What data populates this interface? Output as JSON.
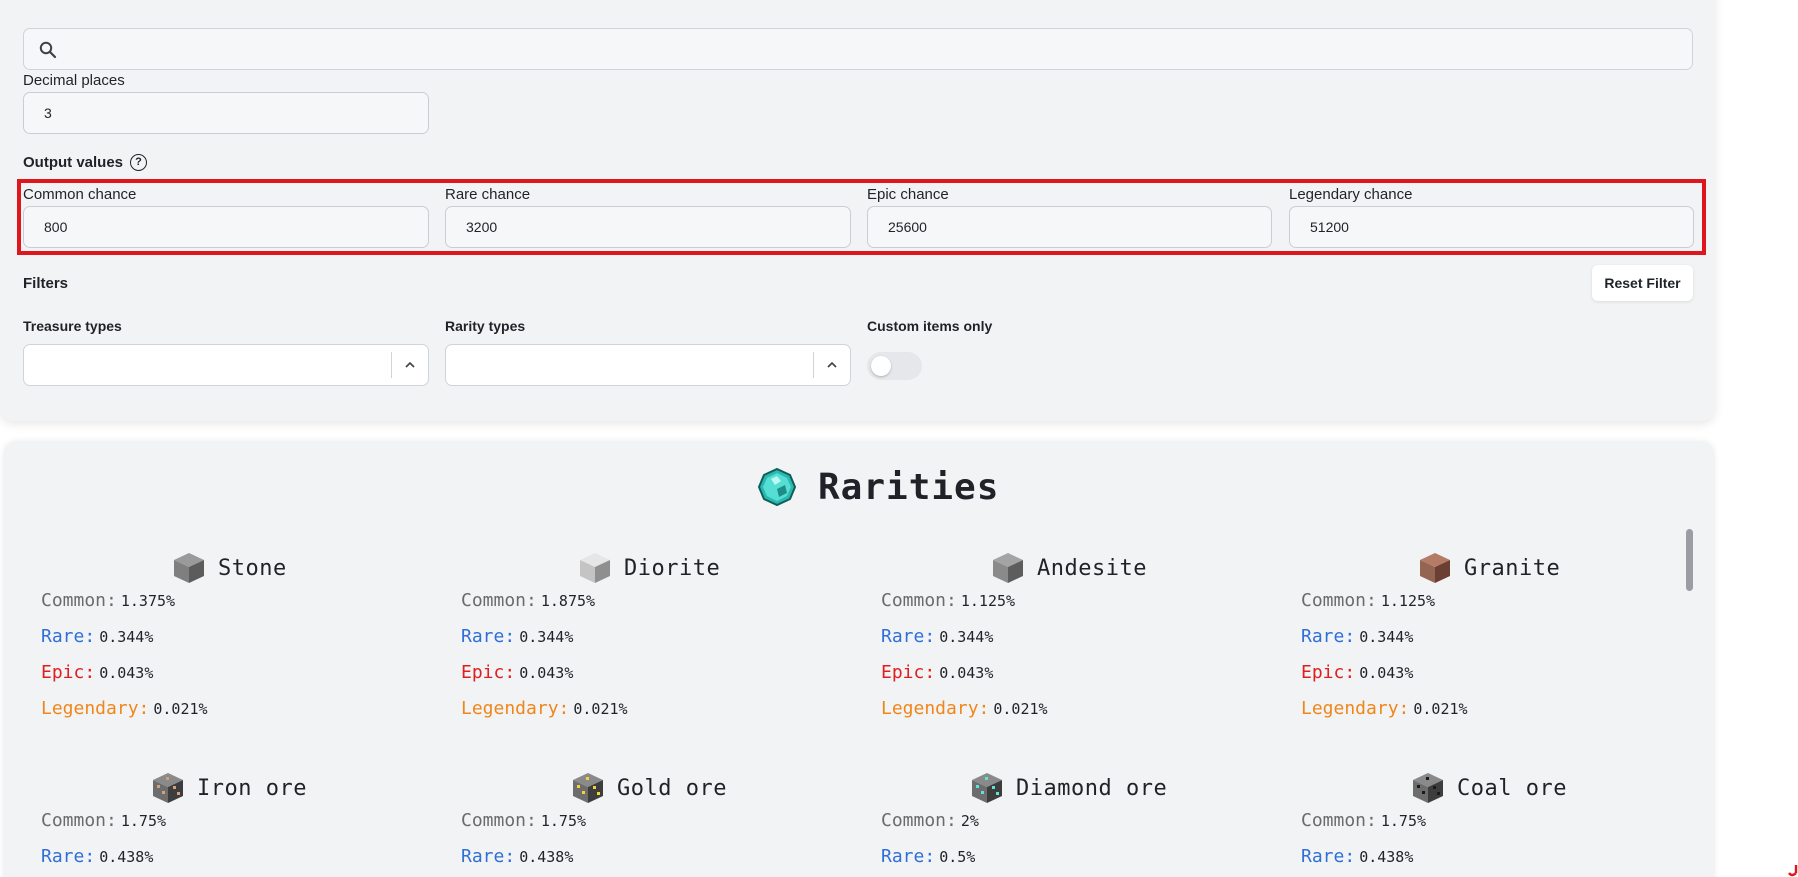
{
  "search": {
    "placeholder": "",
    "value": ""
  },
  "decimal_places": {
    "label": "Decimal places",
    "value": "3"
  },
  "output_values": {
    "label": "Output values",
    "fields": [
      {
        "label": "Common chance",
        "value": "800"
      },
      {
        "label": "Rare chance",
        "value": "3200"
      },
      {
        "label": "Epic chance",
        "value": "25600"
      },
      {
        "label": "Legendary chance",
        "value": "51200"
      }
    ]
  },
  "filters": {
    "label": "Filters",
    "reset_label": "Reset Filter",
    "treasure_types_label": "Treasure types",
    "rarity_types_label": "Rarity types",
    "custom_items_label": "Custom items only",
    "custom_items_on": false
  },
  "rarities": {
    "title": "Rarities",
    "labels": {
      "common": "Common:",
      "rare": "Rare:",
      "epic": "Epic:",
      "legendary": "Legendary:"
    },
    "colors": {
      "common": "#6b6b6b",
      "rare": "#2f6fd8",
      "epic": "#e01e1e",
      "legendary": "#f0861a"
    },
    "blocks": [
      {
        "name": "Stone",
        "icon": "stone-block-icon",
        "common": "1.375%",
        "rare": "0.344%",
        "epic": "0.043%",
        "legendary": "0.021%"
      },
      {
        "name": "Diorite",
        "icon": "diorite-block-icon",
        "common": "1.875%",
        "rare": "0.344%",
        "epic": "0.043%",
        "legendary": "0.021%"
      },
      {
        "name": "Andesite",
        "icon": "andesite-block-icon",
        "common": "1.125%",
        "rare": "0.344%",
        "epic": "0.043%",
        "legendary": "0.021%"
      },
      {
        "name": "Granite",
        "icon": "granite-block-icon",
        "common": "1.125%",
        "rare": "0.344%",
        "epic": "0.043%",
        "legendary": "0.021%"
      },
      {
        "name": "Iron ore",
        "icon": "iron-ore-block-icon",
        "common": "1.75%",
        "rare": "0.438%"
      },
      {
        "name": "Gold ore",
        "icon": "gold-ore-block-icon",
        "common": "1.75%",
        "rare": "0.438%"
      },
      {
        "name": "Diamond ore",
        "icon": "diamond-ore-block-icon",
        "common": "2%",
        "rare": "0.5%"
      },
      {
        "name": "Coal ore",
        "icon": "coal-ore-block-icon",
        "common": "1.75%",
        "rare": "0.438%"
      }
    ]
  }
}
